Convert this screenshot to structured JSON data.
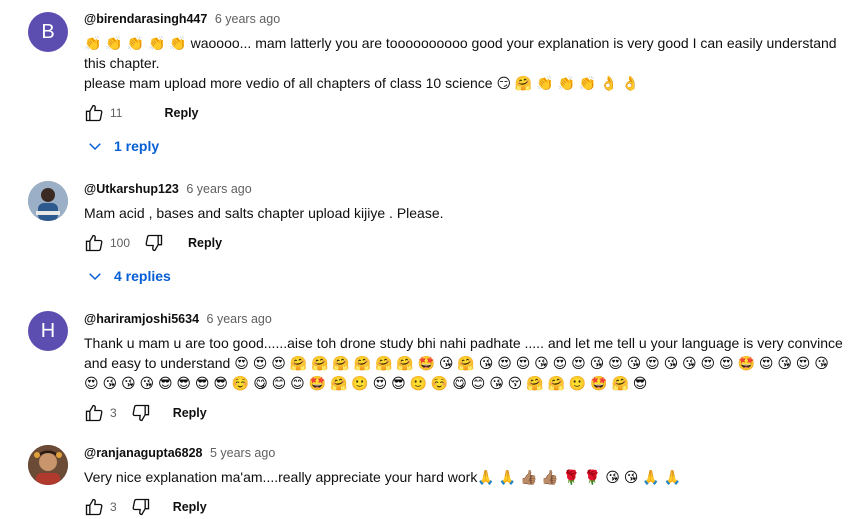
{
  "comments": [
    {
      "avatar_letter": "B",
      "avatar_color": "#5c4db1",
      "author": "@birendarasingh447",
      "time": "6 years ago",
      "text": "👏 👏 👏 👏 👏 waoooo... mam latterly you are toooooooooo good your explanation is very good I can easily understand this chapter.\nplease mam upload more vedio of all chapters of class 10 science 😏 🤗 👏 👏 👏 👌 👌",
      "likes": "11",
      "reply_label": "Reply",
      "replies_label": "1 reply"
    },
    {
      "author": "@Utkarshup123",
      "time": "6 years ago",
      "text": "Mam acid , bases and salts chapter upload kijiye . Please.",
      "likes": "100",
      "reply_label": "Reply",
      "replies_label": "4 replies"
    },
    {
      "avatar_letter": "H",
      "avatar_color": "#5c4db1",
      "author": "@hariramjoshi5634",
      "time": "6 years ago",
      "text": "Thank u mam u are too good......aise toh drone study bhi nahi padhate ..... and let me tell u your language is very convince and easy to understand 😍 😍 😍 🤗 🤗 🤗 🤗 🤗 🤗 🤩 😘 🤗 😘 😍 😍 😘 😍 😍 😘 😍 😘 😍 😘 😘 😍 😍 🤩 😍 😘 😍 😘 😍 😘 😘 😘 😎 😎 😎 😎 ☺️ 😋 😊 😊 🤩 🤗 🙂 😍 😎 🙂 ☺️ 😋 😊 😘 😚 🤗 🤗 🙂 🤩 🤗 😎",
      "likes": "3",
      "reply_label": "Reply"
    },
    {
      "author": "@ranjanagupta6828",
      "time": "5 years ago",
      "text": "Very nice explanation ma'am....really appreciate your hard work🙏 🙏 👍🏽 👍🏽 🌹 🌹 😘 😘 🙏 🙏",
      "likes": "3",
      "reply_label": "Reply"
    }
  ],
  "colors": {
    "link_blue": "#065fd4",
    "meta_gray": "#606060"
  }
}
